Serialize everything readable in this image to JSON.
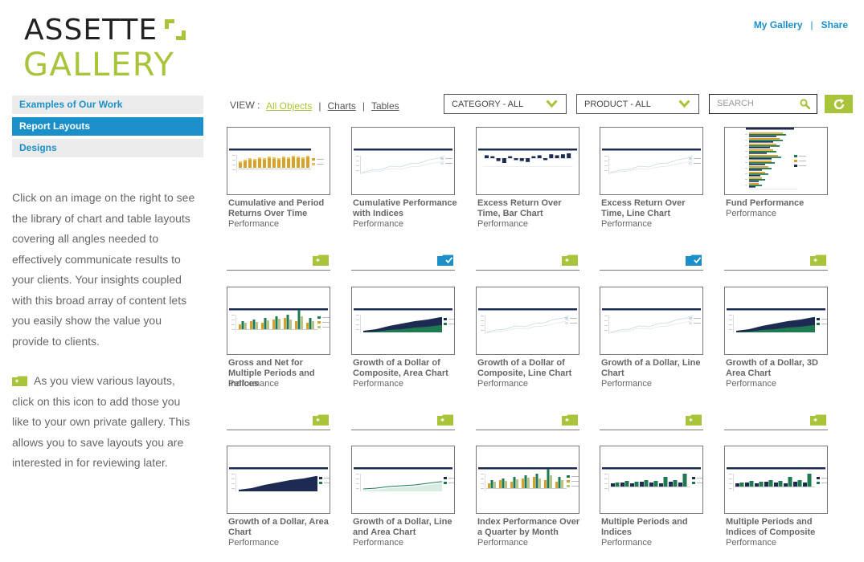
{
  "logo": {
    "top": "ASSETTE",
    "bottom": "GALLERY"
  },
  "header": {
    "my_gallery": "My Gallery",
    "separator": "|",
    "share": "Share"
  },
  "sidebar": {
    "items": [
      {
        "label": "Examples of Our Work",
        "active": false
      },
      {
        "label": "Report Layouts",
        "active": true
      },
      {
        "label": "Designs",
        "active": false
      }
    ],
    "intro": "Click on an image on the right to see the library of chart and table layouts covering all angles needed to effectively communicate results to your clients. Your insights coupled with this broad array of content lets you easily show the value you provide to clients.",
    "intro2": "As you view various layouts, click on this icon to add those you like to your own private gallery. This allows you to save layouts you are interested in for reviewing later."
  },
  "toolbar": {
    "view_label": "VIEW :",
    "views": [
      "All Objects",
      "Charts",
      "Tables"
    ],
    "view_sep": "|",
    "category": "CATEGORY - ALL",
    "product": "PRODUCT - ALL",
    "search_placeholder": "SEARCH"
  },
  "colors": {
    "accent": "#a8c43a",
    "blue": "#1b8fc9",
    "navy": "#1d2b52",
    "gold": "#d9a12a",
    "green": "#1f7a52"
  },
  "cards": [
    {
      "title": "Cumulative and Period Returns Over Time",
      "category": "Performance",
      "thumb": "bar-gold",
      "saved": null
    },
    {
      "title": "Cumulative Performance with Indices",
      "category": "Performance",
      "thumb": "line-light",
      "saved": null
    },
    {
      "title": "Excess Return Over Time, Bar Chart",
      "category": "Performance",
      "thumb": "bar-navy-neg",
      "saved": null
    },
    {
      "title": "Excess Return Over Time, Line Chart",
      "category": "Performance",
      "thumb": "line-light",
      "saved": null
    },
    {
      "title": "Fund Performance",
      "category": "Performance",
      "thumb": "hbar",
      "saved": null
    },
    {
      "title": "Gross and Net for Multiple Periods and Indices",
      "category": "Performance",
      "thumb": "bar-multi-gold",
      "saved": "add"
    },
    {
      "title": "Growth of a Dollar of Composite, Area Chart",
      "category": "Performance",
      "thumb": "area",
      "saved": "saved"
    },
    {
      "title": "Growth of a Dollar of Composite, Line Chart",
      "category": "Performance",
      "thumb": "line-light",
      "saved": "add"
    },
    {
      "title": "Growth of a Dollar, Line Chart",
      "category": "Performance",
      "thumb": "line-light",
      "saved": "saved"
    },
    {
      "title": "Growth of a Dollar, 3D Area Chart",
      "category": "Performance",
      "thumb": "area",
      "saved": "add"
    },
    {
      "title": "Growth of a Dollar, Area Chart",
      "category": "Performance",
      "thumb": "area-navy",
      "saved": "add"
    },
    {
      "title": "Growth of a Dollar, Line and Area Chart",
      "category": "Performance",
      "thumb": "line-area",
      "saved": "add"
    },
    {
      "title": "Index Performance Over a Quarter by Month",
      "category": "Performance",
      "thumb": "bar-multi-gold",
      "saved": "add"
    },
    {
      "title": "Multiple Periods and Indices",
      "category": "Performance",
      "thumb": "bar-navy-green",
      "saved": "add"
    },
    {
      "title": "Multiple Periods and Indices of Composite",
      "category": "Performance",
      "thumb": "bar-navy-green",
      "saved": "add"
    }
  ],
  "row_footers": [
    [
      "add",
      "saved",
      "add",
      "saved",
      "add"
    ],
    [
      "add",
      "add",
      "add",
      "add",
      "add"
    ]
  ]
}
